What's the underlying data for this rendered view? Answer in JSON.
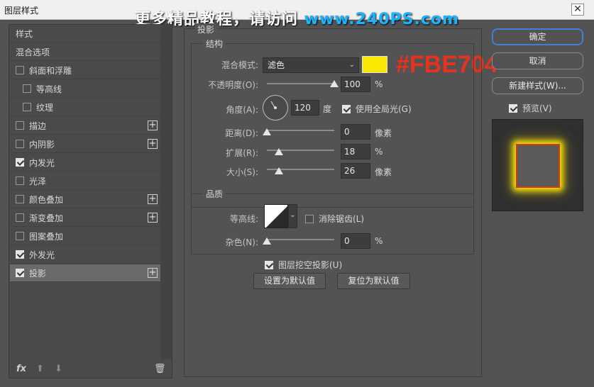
{
  "window": {
    "title": "图层样式",
    "close": "✕"
  },
  "watermark": {
    "text": "更多精品教程，请访问 ",
    "url": "www.240PS.com"
  },
  "annotation": {
    "hex": "#FBE704"
  },
  "colors": {
    "shadow_color": "#FBE704",
    "primary_border": "#3f7fd8"
  },
  "sidebar": {
    "items": [
      {
        "label": "样式",
        "checkbox": false,
        "checked": false,
        "plus": false,
        "indent": false,
        "selected": false
      },
      {
        "label": "混合选项",
        "checkbox": false,
        "checked": false,
        "plus": false,
        "indent": false,
        "selected": false
      },
      {
        "label": "斜面和浮雕",
        "checkbox": true,
        "checked": false,
        "plus": false,
        "indent": false,
        "selected": false
      },
      {
        "label": "等高线",
        "checkbox": true,
        "checked": false,
        "plus": false,
        "indent": true,
        "selected": false
      },
      {
        "label": "纹理",
        "checkbox": true,
        "checked": false,
        "plus": false,
        "indent": true,
        "selected": false
      },
      {
        "label": "描边",
        "checkbox": true,
        "checked": false,
        "plus": true,
        "indent": false,
        "selected": false
      },
      {
        "label": "内阴影",
        "checkbox": true,
        "checked": false,
        "plus": true,
        "indent": false,
        "selected": false
      },
      {
        "label": "内发光",
        "checkbox": true,
        "checked": true,
        "plus": false,
        "indent": false,
        "selected": false
      },
      {
        "label": "光泽",
        "checkbox": true,
        "checked": false,
        "plus": false,
        "indent": false,
        "selected": false
      },
      {
        "label": "颜色叠加",
        "checkbox": true,
        "checked": false,
        "plus": true,
        "indent": false,
        "selected": false
      },
      {
        "label": "渐变叠加",
        "checkbox": true,
        "checked": false,
        "plus": true,
        "indent": false,
        "selected": false
      },
      {
        "label": "图案叠加",
        "checkbox": true,
        "checked": false,
        "plus": false,
        "indent": false,
        "selected": false
      },
      {
        "label": "外发光",
        "checkbox": true,
        "checked": true,
        "plus": false,
        "indent": false,
        "selected": false
      },
      {
        "label": "投影",
        "checkbox": true,
        "checked": true,
        "plus": true,
        "indent": false,
        "selected": true
      }
    ],
    "footer": {
      "fx": "fx",
      "up": "⬆",
      "down": "⬇",
      "trash": "🗑"
    }
  },
  "drop_shadow": {
    "section_title": "投影",
    "structure": {
      "title": "结构",
      "blend_mode_label": "混合模式:",
      "blend_mode_value": "滤色",
      "opacity_label": "不透明度(O):",
      "opacity_value": "100",
      "opacity_percent": 100,
      "angle_label": "角度(A):",
      "angle_value": "120",
      "angle_unit": "度",
      "global_light_label": "使用全局光(G)",
      "distance_label": "距离(D):",
      "distance_value": "0",
      "distance_percent": 0,
      "distance_unit": "像素",
      "spread_label": "扩展(R):",
      "spread_value": "18",
      "spread_percent": 18,
      "size_label": "大小(S):",
      "size_value": "26",
      "size_percent": 18,
      "size_unit": "像素",
      "percent_unit": "%"
    },
    "quality": {
      "title": "品质",
      "contour_label": "等高线:",
      "antialias_label": "消除锯齿(L)",
      "noise_label": "杂色(N):",
      "noise_value": "0",
      "noise_percent": 0,
      "percent_unit": "%"
    },
    "knockout_label": "图层挖空投影(U)",
    "make_default": "设置为默认值",
    "reset_default": "复位为默认值"
  },
  "right": {
    "ok": "确定",
    "cancel": "取消",
    "new_style": "新建样式(W)...",
    "preview_label": "预览(V)"
  }
}
